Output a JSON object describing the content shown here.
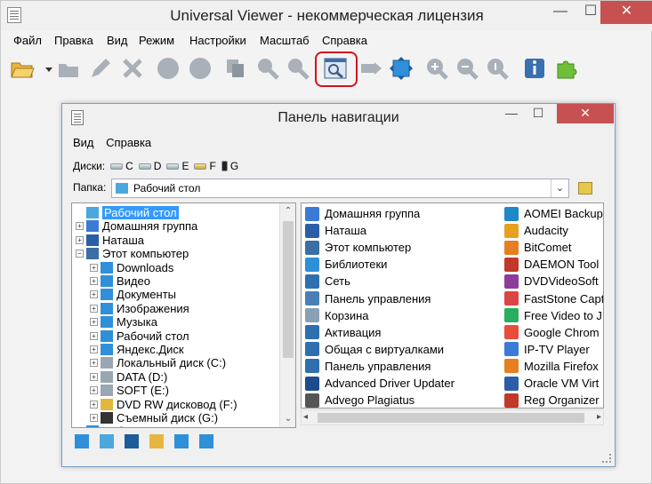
{
  "window": {
    "title": "Universal Viewer - некоммерческая лицензия",
    "min": "—",
    "max": "☐",
    "close": "✕"
  },
  "menu": [
    "Файл",
    "Правка",
    "Вид",
    "Режим",
    "Настройки",
    "Масштаб",
    "Справка"
  ],
  "toolbar_icons": [
    "open-folder-icon",
    "dropdown-arrow-icon",
    "folder-open-icon",
    "edit-icon",
    "close-x-icon",
    "circle-icon",
    "circle-icon",
    "copy-icon",
    "search-icon",
    "search-next-icon",
    "navigation-panel-icon",
    "arrow-right-icon",
    "fit-window-icon",
    "zoom-in-icon",
    "zoom-out-icon",
    "zoom-original-icon",
    "info-icon",
    "plugins-icon"
  ],
  "colors": {
    "highlight_ring": "#d0141a",
    "selection": "#3399ff",
    "close_button": "#c75050"
  },
  "nav": {
    "title": "Панель навигации",
    "min": "—",
    "max": "☐",
    "close": "✕",
    "menu": [
      "Вид",
      "Справка"
    ],
    "disks_label": "Диски:",
    "disks": [
      "C",
      "D",
      "E",
      "F",
      "G"
    ],
    "folder_label": "Папка:",
    "folder_value": "Рабочий стол",
    "tree": [
      {
        "label": "Рабочий стол",
        "indent": 0,
        "expander": "",
        "selected": true,
        "icon_color": "#4aa8de"
      },
      {
        "label": "Домашняя группа",
        "indent": 0,
        "expander": "+",
        "selected": false,
        "icon_color": "#3a7bd5"
      },
      {
        "label": "Наташа",
        "indent": 0,
        "expander": "+",
        "selected": false,
        "icon_color": "#2a5fa8"
      },
      {
        "label": "Этот компьютер",
        "indent": 0,
        "expander": "−",
        "selected": false,
        "icon_color": "#3b6ea5"
      },
      {
        "label": "Downloads",
        "indent": 1,
        "expander": "+",
        "selected": false,
        "icon_color": "#2f8fd8"
      },
      {
        "label": "Видео",
        "indent": 1,
        "expander": "+",
        "selected": false,
        "icon_color": "#2f8fd8"
      },
      {
        "label": "Документы",
        "indent": 1,
        "expander": "+",
        "selected": false,
        "icon_color": "#2f8fd8"
      },
      {
        "label": "Изображения",
        "indent": 1,
        "expander": "+",
        "selected": false,
        "icon_color": "#2f8fd8"
      },
      {
        "label": "Музыка",
        "indent": 1,
        "expander": "+",
        "selected": false,
        "icon_color": "#2f8fd8"
      },
      {
        "label": "Рабочий стол",
        "indent": 1,
        "expander": "+",
        "selected": false,
        "icon_color": "#2f8fd8"
      },
      {
        "label": "Яндекс.Диск",
        "indent": 1,
        "expander": "+",
        "selected": false,
        "icon_color": "#2f8fd8"
      },
      {
        "label": "Локальный диск (C:)",
        "indent": 1,
        "expander": "+",
        "selected": false,
        "icon_color": "#9aa6b2"
      },
      {
        "label": "DATA (D:)",
        "indent": 1,
        "expander": "+",
        "selected": false,
        "icon_color": "#9aa6b2"
      },
      {
        "label": "SOFT (E:)",
        "indent": 1,
        "expander": "+",
        "selected": false,
        "icon_color": "#9aa6b2"
      },
      {
        "label": "DVD RW дисковод (F:)",
        "indent": 1,
        "expander": "+",
        "selected": false,
        "icon_color": "#e1b83c"
      },
      {
        "label": "Съемный диск (G:)",
        "indent": 1,
        "expander": "+",
        "selected": false,
        "icon_color": "#333333"
      },
      {
        "label": "Библиотеки",
        "indent": 0,
        "expander": "+",
        "selected": false,
        "icon_color": "#2f8fd8"
      }
    ],
    "files_col1": [
      {
        "label": "Домашняя группа",
        "icon_color": "#3a7bd5"
      },
      {
        "label": "Наташа",
        "icon_color": "#2a5fa8"
      },
      {
        "label": "Этот компьютер",
        "icon_color": "#3b6ea5"
      },
      {
        "label": "Библиотеки",
        "icon_color": "#2f8fd8"
      },
      {
        "label": "Сеть",
        "icon_color": "#2f6fb0"
      },
      {
        "label": "Панель управления",
        "icon_color": "#4a7fb5"
      },
      {
        "label": "Корзина",
        "icon_color": "#8aa0b5"
      },
      {
        "label": "Активация",
        "icon_color": "#2f6fb0"
      },
      {
        "label": "Общая с виртуалками",
        "icon_color": "#2f6fb0"
      },
      {
        "label": "Панель управления",
        "icon_color": "#2f6fb0"
      },
      {
        "label": "Advanced Driver Updater",
        "icon_color": "#1d4d8c"
      },
      {
        "label": "Advego Plagiatus",
        "icon_color": "#555555"
      }
    ],
    "files_col2": [
      {
        "label": "AOMEI Backup",
        "icon_color": "#1e88c9"
      },
      {
        "label": "Audacity",
        "icon_color": "#e8a020"
      },
      {
        "label": "BitComet",
        "icon_color": "#e67e22"
      },
      {
        "label": "DAEMON Tool",
        "icon_color": "#c0392b"
      },
      {
        "label": "DVDVideoSoft",
        "icon_color": "#8e3b9c"
      },
      {
        "label": "FastStone Capt",
        "icon_color": "#d44"
      },
      {
        "label": "Free Video to J",
        "icon_color": "#27ae60"
      },
      {
        "label": "Google Chrom",
        "icon_color": "#e74c3c"
      },
      {
        "label": "IP-TV Player",
        "icon_color": "#3a7bd5"
      },
      {
        "label": "Mozilla Firefox",
        "icon_color": "#e67e22"
      },
      {
        "label": "Oracle VM Virt",
        "icon_color": "#2a5fa8"
      },
      {
        "label": "Reg Organizer",
        "icon_color": "#c0392b"
      }
    ]
  }
}
